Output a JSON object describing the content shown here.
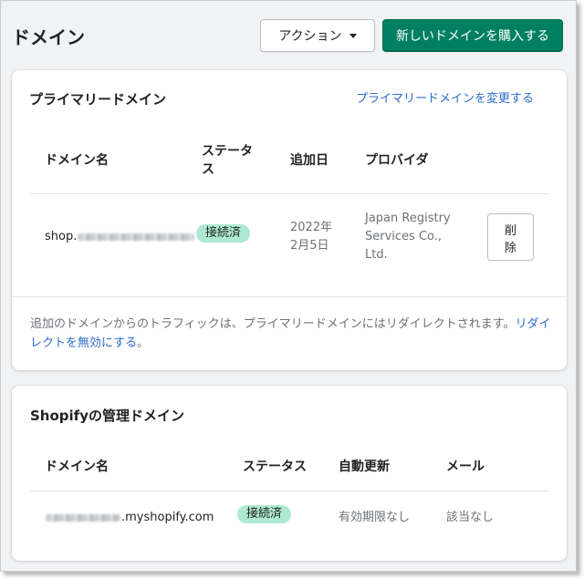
{
  "header": {
    "title": "ドメイン",
    "action_label": "アクション",
    "buy_label": "新しいドメインを購入する"
  },
  "primary": {
    "title": "プライマリードメイン",
    "change_link": "プライマリードメインを変更する",
    "columns": {
      "name": "ドメイン名",
      "status_line1": "ステータ",
      "status_line2": "ス",
      "added": "追加日",
      "provider": "プロバイダ"
    },
    "row": {
      "domain_prefix": "shop.",
      "status": "接続済",
      "added_line1": "2022年",
      "added_line2": "2月5日",
      "provider_line1": "Japan Registry",
      "provider_line2": "Services Co.,",
      "provider_line3": "Ltd.",
      "delete_line1": "削",
      "delete_line2": "除"
    },
    "note_text": "追加のドメインからのトラフィックは、プライマリードメインにはリダイレクトされます。",
    "note_link": "リダイレクトを無効にする",
    "note_end": "。"
  },
  "managed": {
    "title": "Shopifyの管理ドメイン",
    "columns": {
      "name": "ドメイン名",
      "status": "ステータス",
      "renew": "自動更新",
      "email": "メール"
    },
    "row": {
      "domain_suffix": ".myshopify.com",
      "status": "接続済",
      "renew": "有効期限なし",
      "email": "該当なし"
    }
  },
  "colors": {
    "primary_button": "#008060",
    "link": "#2c6ecb",
    "badge_success": "#aee9d1",
    "background": "#f1f2f3"
  }
}
